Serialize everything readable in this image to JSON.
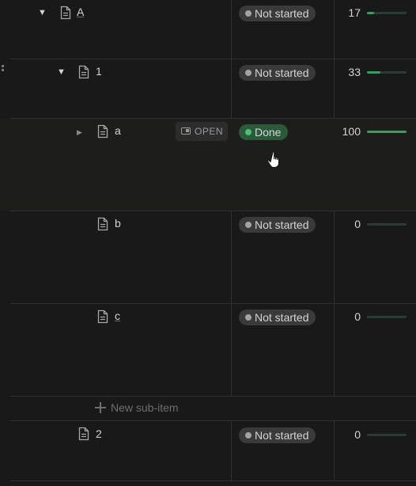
{
  "rows": [
    {
      "title": "A",
      "status": "Not started",
      "progress": 17
    },
    {
      "title": "1",
      "status": "Not started",
      "progress": 33
    },
    {
      "title": "a",
      "status": "Done",
      "progress": 100,
      "open_label": "OPEN"
    },
    {
      "title": "b",
      "status": "Not started",
      "progress": 0
    },
    {
      "title": "c",
      "status": "Not started",
      "progress": 0
    },
    {
      "title": "2",
      "status": "Not started",
      "progress": 0
    }
  ],
  "new_sub_item_label": "New sub-item",
  "colors": {
    "background": "#191919",
    "status_default": "#3a3a3a",
    "status_done": "#2b5a3b",
    "progress_fill": "#3f9a5f"
  }
}
